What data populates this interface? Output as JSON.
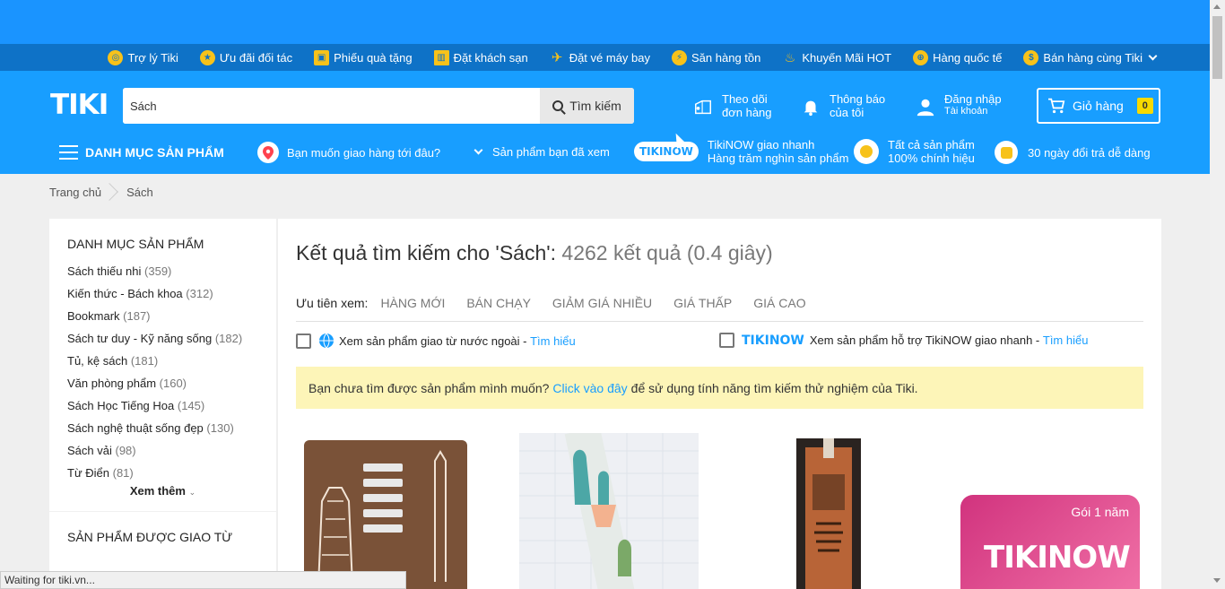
{
  "topbar": {
    "links": [
      {
        "label": "Trợ lý Tiki",
        "icon": "assistant-icon"
      },
      {
        "label": "Ưu đãi đối tác",
        "icon": "partner-icon"
      },
      {
        "label": "Phiếu quà tặng",
        "icon": "gift-icon"
      },
      {
        "label": "Đặt khách sạn",
        "icon": "hotel-icon"
      },
      {
        "label": "Đặt vé máy bay",
        "icon": "plane-icon"
      },
      {
        "label": "Săn hàng tồn",
        "icon": "lightning-icon"
      },
      {
        "label": "Khuyến Mãi HOT",
        "icon": "fire-icon"
      },
      {
        "label": "Hàng quốc tế",
        "icon": "globe-icon"
      },
      {
        "label": "Bán hàng cùng Tiki",
        "icon": "money-bag-icon"
      }
    ]
  },
  "header": {
    "logo": "TIKI",
    "search_value": "Sách",
    "search_button": "Tìm kiếm",
    "track_order_l1": "Theo dõi",
    "track_order_l2": "đơn hàng",
    "notify_l1": "Thông báo",
    "notify_l2": "của tôi",
    "login": "Đăng nhập",
    "account": "Tài khoản",
    "cart": "Giỏ hàng",
    "cart_count": "0"
  },
  "nav": {
    "categories": "DANH MỤC SẢN PHẨM",
    "delivery": "Bạn muốn giao hàng tới đâu?",
    "viewed": "Sản phẩm bạn đã xem",
    "tikinow_logo": "TIKINOW",
    "tikinow_l1": "TikiNOW giao nhanh",
    "tikinow_l2": "Hàng trăm nghìn sản phẩm",
    "genuine_l1": "Tất cả sản phẩm",
    "genuine_l2": "100% chính hiệu",
    "return": "30 ngày đổi trả dễ dàng"
  },
  "breadcrumb": {
    "home": "Trang chủ",
    "current": "Sách"
  },
  "sidebar": {
    "title": "DANH MỤC SẢN PHẨM",
    "items": [
      {
        "label": "Sách thiếu nhi",
        "count": "(359)"
      },
      {
        "label": "Kiến thức - Bách khoa",
        "count": "(312)"
      },
      {
        "label": "Bookmark",
        "count": "(187)"
      },
      {
        "label": "Sách tư duy - Kỹ năng sống",
        "count": "(182)"
      },
      {
        "label": "Tủ, kệ sách",
        "count": "(181)"
      },
      {
        "label": "Văn phòng phẩm",
        "count": "(160)"
      },
      {
        "label": "Sách Học Tiếng Hoa",
        "count": "(145)"
      },
      {
        "label": "Sách nghệ thuật sống đẹp",
        "count": "(130)"
      },
      {
        "label": "Sách vải",
        "count": "(98)"
      },
      {
        "label": "Từ Điển",
        "count": "(81)"
      }
    ],
    "more": "Xem thêm",
    "section2": "SẢN PHẨM ĐƯỢC GIAO TỪ"
  },
  "results": {
    "title": "Kết quả tìm kiếm cho 'Sách':",
    "meta": "4262 kết quả (0.4 giây)",
    "sort_label": "Ưu tiên xem:",
    "sorts": [
      "HÀNG MỚI",
      "BÁN CHẠY",
      "GIẢM GIÁ NHIỀU",
      "GIÁ THẤP",
      "GIÁ CAO"
    ],
    "filter1": "Xem sản phẩm giao từ nước ngoài -",
    "filter1_link": "Tìm hiểu",
    "filter2_logo": "TIKINOW",
    "filter2": "Xem sản phẩm hỗ trợ TikiNOW giao nhanh -",
    "filter2_link": "Tìm hiểu",
    "notice_pre": "Bạn chưa tìm được sản phẩm mình muốn?",
    "notice_link": "Click vào đây",
    "notice_post": "để sử dụng tính năng tìm kiếm thử nghiệm của Tiki.",
    "promo_badge": "Gói 1 năm",
    "promo_logo": "TIKINOW"
  },
  "status": "Waiting for tiki.vn...",
  "colors": {
    "brand": "#189eff",
    "topbar": "#0e72c7",
    "notice": "#fdf5b8",
    "link": "#189eff"
  }
}
